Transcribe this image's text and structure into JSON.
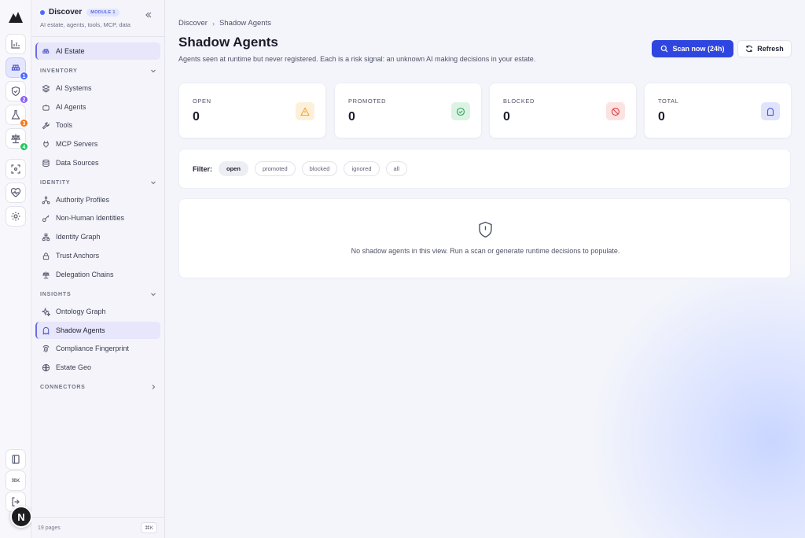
{
  "sidebar": {
    "title": "Discover",
    "module_badge": "MODULE 1",
    "subtitle": "AI estate, agents, tools, MCP, data",
    "top_item": "AI Estate",
    "sections": {
      "inventory": "INVENTORY",
      "identity": "IDENTITY",
      "insights": "INSIGHTS",
      "connectors": "CONNECTORS"
    },
    "inventory_items": [
      "AI Systems",
      "AI Agents",
      "Tools",
      "MCP Servers",
      "Data Sources"
    ],
    "identity_items": [
      "Authority Profiles",
      "Non-Human Identities",
      "Identity Graph",
      "Trust Anchors",
      "Delegation Chains"
    ],
    "insights_items": [
      "Ontology Graph",
      "Shadow Agents",
      "Compliance Fingerprint",
      "Estate Geo"
    ],
    "footer_pages": "19 pages",
    "footer_shortcut": "⌘K"
  },
  "rail": {
    "badges": [
      "1",
      "2",
      "3",
      "4"
    ],
    "shortcut": "⌘K",
    "user_initial": "N"
  },
  "breadcrumb": {
    "parent": "Discover",
    "current": "Shadow Agents"
  },
  "header": {
    "title": "Shadow Agents",
    "description": "Agents seen at runtime but never registered. Each is a risk signal: an unknown AI making decisions in your estate.",
    "scan_button": "Scan now (24h)",
    "refresh_button": "Refresh"
  },
  "stats": [
    {
      "label": "OPEN",
      "value": "0",
      "icon": "warning-icon",
      "color": "#f5a524"
    },
    {
      "label": "PROMOTED",
      "value": "0",
      "icon": "check-circle-icon",
      "color": "#2e9e5b"
    },
    {
      "label": "BLOCKED",
      "value": "0",
      "icon": "ban-icon",
      "color": "#e5484d"
    },
    {
      "label": "TOTAL",
      "value": "0",
      "icon": "ghost-icon",
      "color": "#4a55c9"
    }
  ],
  "filter": {
    "label": "Filter:",
    "options": [
      "open",
      "promoted",
      "blocked",
      "ignored",
      "all"
    ],
    "selected": "open"
  },
  "empty_state": {
    "icon": "shield-alert-icon",
    "message": "No shadow agents in this view. Run a scan or generate runtime decisions to populate."
  },
  "colors": {
    "accent": "#2f45e0",
    "badge_blue": "#4b6bfb",
    "badge_purple": "#8b5cf6",
    "badge_orange": "#f97316",
    "badge_green": "#22c55e"
  }
}
